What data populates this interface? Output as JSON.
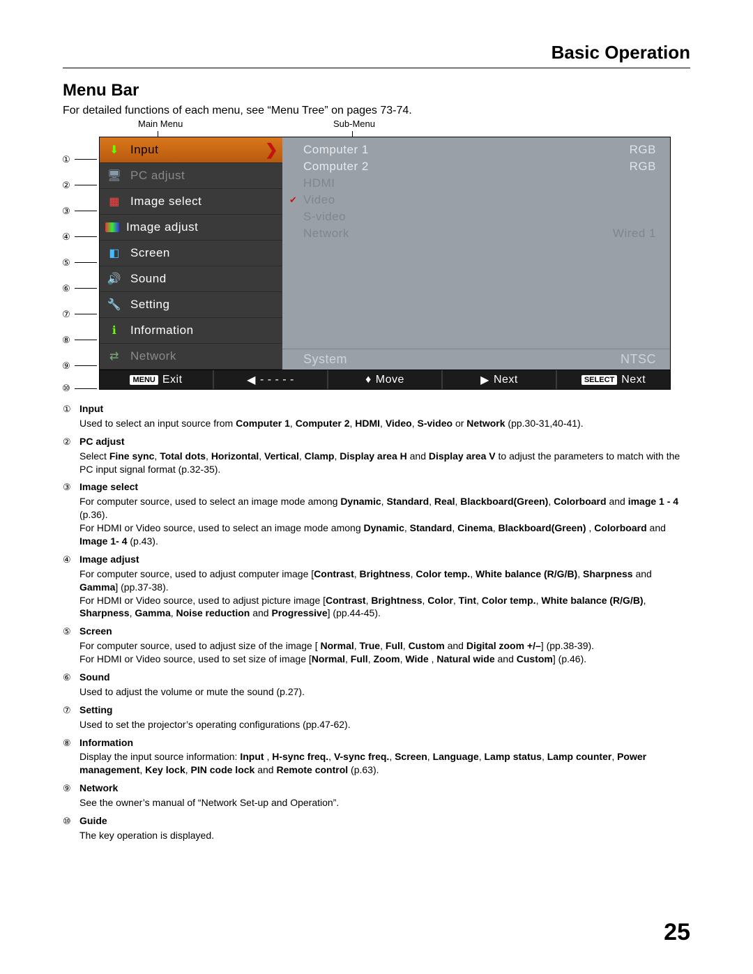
{
  "header": {
    "section": "Basic Operation"
  },
  "title": "Menu Bar",
  "intro": "For detailed functions of each menu, see “Menu Tree” on pages 73-74.",
  "labels": {
    "main": "Main Menu",
    "sub": "Sub-Menu"
  },
  "callouts": [
    "①",
    "②",
    "③",
    "④",
    "⑤",
    "⑥",
    "⑦",
    "⑧",
    "⑨",
    "⑩"
  ],
  "main_menu": [
    {
      "label": "Input",
      "state": "selected"
    },
    {
      "label": "PC adjust",
      "state": "dim"
    },
    {
      "label": "Image select",
      "state": ""
    },
    {
      "label": "Image adjust",
      "state": ""
    },
    {
      "label": "Screen",
      "state": ""
    },
    {
      "label": "Sound",
      "state": ""
    },
    {
      "label": "Setting",
      "state": ""
    },
    {
      "label": "Information",
      "state": ""
    },
    {
      "label": "Network",
      "state": "dim"
    }
  ],
  "sub_menu": [
    {
      "label": "Computer 1",
      "value": "RGB",
      "state": ""
    },
    {
      "label": "Computer 2",
      "value": "RGB",
      "state": ""
    },
    {
      "label": "HDMI",
      "value": "",
      "state": "dim"
    },
    {
      "label": "Video",
      "value": "",
      "state": "dim checked"
    },
    {
      "label": "S-video",
      "value": "",
      "state": "dim"
    },
    {
      "label": "Network",
      "value": "Wired 1",
      "state": "dim"
    }
  ],
  "system_row": {
    "label": "System",
    "value": "NTSC"
  },
  "guide_bar": {
    "exit_btn": "MENU",
    "exit": "Exit",
    "back": "- - - - -",
    "move": "Move",
    "next": "Next",
    "select_btn": "SELECT",
    "select_next": "Next"
  },
  "descriptions": [
    {
      "num": "①",
      "title": "Input",
      "html": "Used to select an input source from <b>Computer 1</b>, <b>Computer 2</b>, <b>HDMI</b>, <b>Video</b>, <b>S-video</b> or <b>Network</b> (pp.30-31,40-41)."
    },
    {
      "num": "②",
      "title": "PC adjust",
      "html": "Select <b>Fine sync</b>, <b>Total dots</b>, <b>Horizontal</b>, <b>Vertical</b>, <b>Clamp</b>, <b>Display area H</b> and <b>Display area V</b> to adjust the parameters to match with the PC input signal format (p.32-35)."
    },
    {
      "num": "③",
      "title": "Image select",
      "html": "For computer source, used to select an image mode among <b>Dynamic</b>, <b>Standard</b>, <b>Real</b>, <b>Blackboard(Green)</b>, <b>Colorboard</b> and <b>image 1 - 4</b> (p.36).<br>For HDMI or Video source, used to select an image mode among <b>Dynamic</b>, <b>Standard</b>, <b>Cinema</b>, <b>Blackboard(Green)</b> , <b>Colorboard</b> and <b>Image 1- 4</b> (p.43)."
    },
    {
      "num": "④",
      "title": "Image adjust",
      "html": "For computer source, used to adjust computer image [<b>Contrast</b>, <b>Brightness</b>, <b>Color temp.</b>, <b>White balance (R/G/B)</b>, <b>Sharpness</b> and <b>Gamma</b>] (pp.37-38).<br>For HDMI or Video source, used to adjust picture image [<b>Contrast</b>, <b>Brightness</b>, <b>Color</b>, <b>Tint</b>, <b>Color temp.</b>, <b>White balance (R/G/B)</b>, <b>Sharpness</b>, <b>Gamma</b>, <b>Noise reduction</b> and <b>Progressive</b>] (pp.44-45)."
    },
    {
      "num": "⑤",
      "title": "Screen",
      "html": "For computer source, used to adjust size of the image [ <b>Normal</b>, <b>True</b>, <b>Full</b>, <b>Custom</b> and <b>Digital zoom +/–</b>] (pp.38-39).<br>For HDMI or Video source, used to set size of image [<b>Normal</b>, <b>Full</b>, <b>Zoom</b>, <b>Wide</b> , <b>Natural wide</b> and <b>Custom</b>] (p.46)."
    },
    {
      "num": "⑥",
      "title": "Sound",
      "html": "Used to adjust the volume or mute the sound (p.27)."
    },
    {
      "num": "⑦",
      "title": "Setting",
      "html": "Used to set the projector’s operating configurations (pp.47-62)."
    },
    {
      "num": "⑧",
      "title": "Information",
      "html": "Display the input source information: <b>Input</b> , <b>H-sync freq.</b>, <b>V-sync freq.</b>, <b>Screen</b>, <b>Language</b>, <b>Lamp status</b>, <b>Lamp counter</b>, <b>Power management</b>, <b>Key lock</b>, <b>PIN code lock</b> and <b>Remote control</b> (p.63)."
    },
    {
      "num": "⑨",
      "title": "Network",
      "html": "See the owner’s manual of “Network Set-up and Operation”."
    },
    {
      "num": "⑩",
      "title": "Guide",
      "html": "The key operation is displayed."
    }
  ],
  "page_number": "25"
}
